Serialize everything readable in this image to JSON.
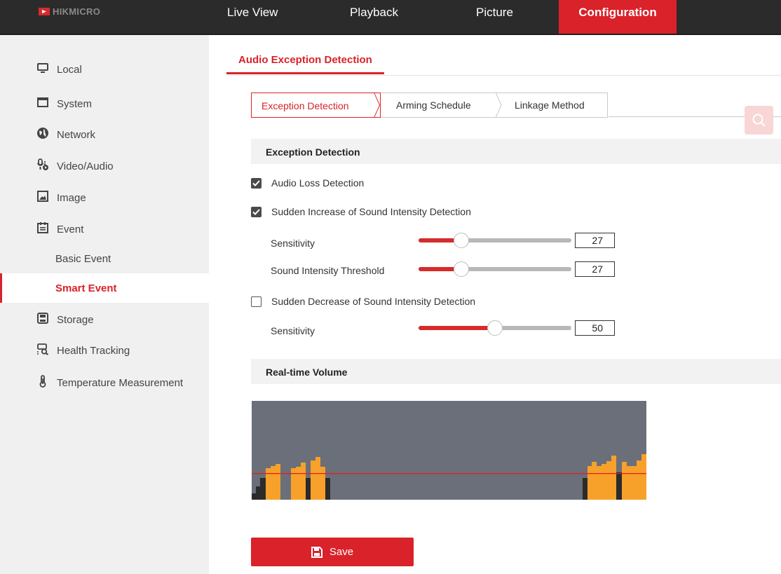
{
  "header": {
    "logo_text": "HIKMICRO",
    "nav": {
      "live_view": "Live View",
      "playback": "Playback",
      "picture": "Picture",
      "configuration": "Configuration"
    },
    "accent_color": "#d9222a"
  },
  "sidebar": {
    "local": "Local",
    "system": "System",
    "network": "Network",
    "video_audio": "Video/Audio",
    "image": "Image",
    "event": "Event",
    "basic_event": "Basic Event",
    "smart_event": "Smart Event",
    "storage": "Storage",
    "health_tracking": "Health Tracking",
    "temperature_measurement": "Temperature Measurement",
    "active_item": "Smart Event"
  },
  "main": {
    "page_tab": "Audio Exception Detection",
    "steps": {
      "exception_detection": "Exception Detection",
      "arming_schedule": "Arming Schedule",
      "linkage_method": "Linkage Method"
    },
    "exception_section": {
      "title": "Exception Detection",
      "audio_loss": {
        "label": "Audio Loss Detection",
        "checked": true
      },
      "sudden_increase": {
        "label": "Sudden Increase of Sound Intensity Detection",
        "checked": true,
        "sensitivity_label": "Sensitivity",
        "sensitivity_value": "27",
        "threshold_label": "Sound Intensity Threshold",
        "threshold_value": "27"
      },
      "sudden_decrease": {
        "label": "Sudden Decrease of Sound Intensity Detection",
        "checked": false,
        "sensitivity_label": "Sensitivity",
        "sensitivity_value": "50"
      }
    },
    "volume_section": {
      "title": "Real-time Volume"
    },
    "save_label": "Save"
  }
}
